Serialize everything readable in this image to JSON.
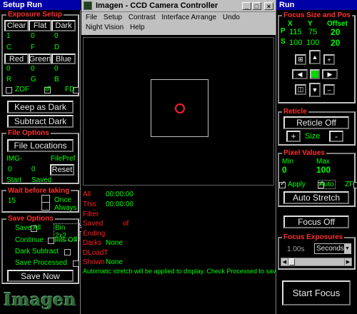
{
  "setup_panel": {
    "title": "Setup Run",
    "exposure_setup": {
      "title": "Exposure Setup",
      "buttons_top": [
        "Clear",
        "Flat",
        "Dark"
      ],
      "values_top": [
        "1",
        "0",
        "0"
      ],
      "letters_top": [
        "C",
        "F",
        "D"
      ],
      "buttons_mid": [
        "Red",
        "Green",
        "Blue"
      ],
      "values_mid": [
        "0",
        "0",
        "0"
      ],
      "letters_mid": [
        "R",
        "G",
        "B"
      ],
      "checks": [
        "ZOF",
        "IF",
        "FD"
      ]
    },
    "keep_as_dark": "Keep as Dark",
    "subtract_dark": "Subtract Dark",
    "file_options": {
      "title": "File Options",
      "file_locations": "File Locations",
      "img_label": "IMG-",
      "file_pref_label": "FilePref",
      "start_value": "0",
      "saved_value": "0",
      "start_label": "Start",
      "saved_label": "Saved",
      "reset": "Reset"
    },
    "wait": {
      "title": "Wait before taking",
      "value": "15",
      "once": "Once",
      "always": "Always"
    },
    "save_options": {
      "title": "Save Options",
      "save_all": "Save All",
      "bin": "Bin 2x2",
      "continue": "Continue",
      "ints_off": "Ints Off",
      "dark_subtract": "Dark Subtract",
      "save_processed": "Save Processed",
      "save_now": "Save Now"
    },
    "logo": "Imagen"
  },
  "main_window": {
    "title": "Imagen - CCD Camera Controller",
    "menu_row1": [
      "File",
      "Setup",
      "Contrast",
      "Interface Arrange",
      "Undo"
    ],
    "menu_row2": [
      "Night Vision",
      "Help"
    ],
    "status": [
      {
        "label": "All",
        "value": "00:00:00"
      },
      {
        "label": "This",
        "value": "00:00:00"
      },
      {
        "label": "Filter",
        "value": ""
      },
      {
        "label": "Saved",
        "value": "of"
      },
      {
        "label": "Ending",
        "value": ""
      },
      {
        "label": "Darks",
        "value": "None"
      },
      {
        "label": "DLoadT",
        "value": ""
      },
      {
        "label": "Shown",
        "value": "None"
      }
    ],
    "message": "Automatic stretch will be applied to display. Check Processed to save"
  },
  "run_panel": {
    "title": "Run",
    "focus_size": {
      "title": "Focus Size and Pos",
      "col_x": "X",
      "col_y": "Y",
      "col_offset": "Offset",
      "row_p": "P",
      "p_x": "115",
      "p_y": "75",
      "p_offset": "20",
      "row_s": "S",
      "s_x": "100",
      "s_y": "100",
      "s_offset": "20"
    },
    "reticle": {
      "title": "Reticle",
      "toggle": "Reticle Off",
      "plus": "+",
      "size_label": "Size",
      "minus": "-"
    },
    "pixel_values": {
      "title": "Pixel Values",
      "min_label": "Min",
      "max_label": "Max",
      "min_value": "0",
      "max_value": "100",
      "apply": "Apply",
      "auto": "Auto",
      "zf": "ZF",
      "auto_stretch": "Auto Stretch"
    },
    "focus_off": "Focus Off",
    "focus_exposures": {
      "title": "Focus Exposures",
      "value": "1.00s",
      "unit": "Seconds"
    },
    "start_focus": "Start Focus"
  },
  "colors": {
    "title_bar": "#0000a8",
    "group_title": "#ff3030",
    "text_green": "#00ff00",
    "reticle_circle": "#ff2020"
  }
}
